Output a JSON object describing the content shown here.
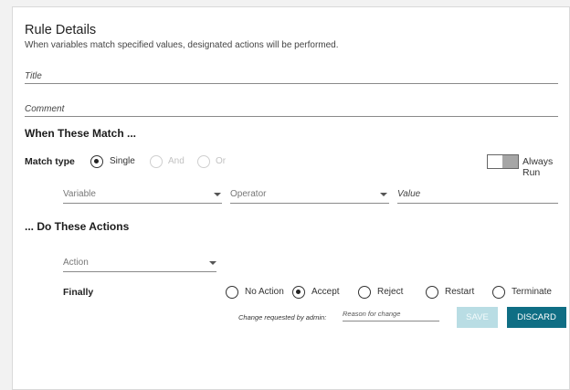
{
  "header": {
    "title": "Rule Details",
    "description": "When variables match specified values, designated actions will be performed."
  },
  "fields": {
    "title_label": "Title",
    "comment_label": "Comment"
  },
  "match_section": {
    "heading": "When These Match ...",
    "match_type_label": "Match type",
    "options": [
      {
        "label": "Single",
        "selected": true,
        "enabled": true
      },
      {
        "label": "And",
        "selected": false,
        "enabled": false
      },
      {
        "label": "Or",
        "selected": false,
        "enabled": false
      }
    ],
    "always_run_label": "Always Run",
    "variable_placeholder": "Variable",
    "operator_placeholder": "Operator",
    "value_label": "Value"
  },
  "actions_section": {
    "heading": "... Do These Actions",
    "action_placeholder": "Action",
    "finally_label": "Finally",
    "finally_options": [
      {
        "label": "No Action",
        "selected": false
      },
      {
        "label": "Accept",
        "selected": true
      },
      {
        "label": "Reject",
        "selected": false
      },
      {
        "label": "Restart",
        "selected": false
      },
      {
        "label": "Terminate",
        "selected": false
      }
    ]
  },
  "footer": {
    "change_requested_label": "Change requested by admin:",
    "reason_placeholder": "Reason for change",
    "save_label": "SAVE",
    "discard_label": "DISCARD"
  },
  "colors": {
    "primary": "#0f6e84",
    "primary_disabled": "#b9dde4"
  }
}
